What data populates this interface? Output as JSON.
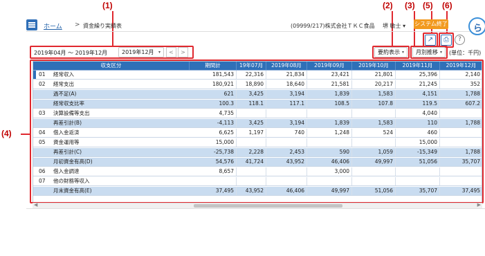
{
  "callouts": [
    "(1)",
    "(2)",
    "(3)",
    "(5)",
    "(6)",
    "(4)"
  ],
  "header": {
    "home": "ホーム",
    "separator": ">",
    "page_title": "資金繰り実績表",
    "company": "(09999/217)株式会社ＴＫＣ食品",
    "user": "堺 敏士",
    "user_caret": "▾",
    "system_end": "システム終了",
    "avatar_glyph": "ら"
  },
  "icons": {
    "menu": "hamburger-menu-icon",
    "export": "↗",
    "print": "⎙",
    "help": "?"
  },
  "filters": {
    "period": "2019年04月 ～ 2019年12月",
    "month_select": "2019年12月",
    "prev": "<",
    "next": ">",
    "summary_select": "要約表示",
    "view_select": "月別推移",
    "caret": "▾",
    "unit": "(単位：千円)"
  },
  "table": {
    "columns": [
      "収支区分",
      "期間計",
      "19年07月",
      "2019年08月",
      "2019年09月",
      "2019年10月",
      "2019年11月",
      "2019年12月"
    ],
    "rows": [
      {
        "code": "01",
        "label": "経常収入",
        "values": [
          "181,543",
          "22,316",
          "21,834",
          "23,421",
          "21,801",
          "25,396",
          "2,140"
        ],
        "style": "white"
      },
      {
        "code": "02",
        "label": "経常支出",
        "values": [
          "180,921",
          "18,890",
          "18,640",
          "21,581",
          "20,217",
          "21,245",
          "352"
        ],
        "style": "white"
      },
      {
        "code": "",
        "label": "過不足(A)",
        "values": [
          "621",
          "3,425",
          "3,194",
          "1,839",
          "1,583",
          "4,151",
          "1,788"
        ],
        "style": "blue"
      },
      {
        "code": "",
        "label": "経常収支比率",
        "values": [
          "100.3",
          "118.1",
          "117.1",
          "108.5",
          "107.8",
          "119.5",
          "607.2"
        ],
        "style": "blue"
      },
      {
        "code": "03",
        "label": "決算設備等支出",
        "values": [
          "4,735",
          "",
          "",
          "",
          "",
          "4,040",
          ""
        ],
        "style": "white"
      },
      {
        "code": "",
        "label": "再差引計(B)",
        "values": [
          "-4,113",
          "3,425",
          "3,194",
          "1,839",
          "1,583",
          "110",
          "1,788"
        ],
        "style": "blue"
      },
      {
        "code": "04",
        "label": "借入金返済",
        "values": [
          "6,625",
          "1,197",
          "740",
          "1,248",
          "524",
          "460",
          ""
        ],
        "style": "white"
      },
      {
        "code": "05",
        "label": "資金運用等",
        "values": [
          "15,000",
          "",
          "",
          "",
          "",
          "15,000",
          ""
        ],
        "style": "white"
      },
      {
        "code": "",
        "label": "再差引計(C)",
        "values": [
          "-25,738",
          "2,228",
          "2,453",
          "590",
          "1,059",
          "-15,349",
          "1,788"
        ],
        "style": "blue"
      },
      {
        "code": "",
        "label": "月初資金有高(D)",
        "values": [
          "54,576",
          "41,724",
          "43,952",
          "46,406",
          "49,997",
          "51,056",
          "35,707"
        ],
        "style": "blue"
      },
      {
        "code": "06",
        "label": "借入金調達",
        "values": [
          "8,657",
          "",
          "",
          "3,000",
          "",
          "",
          ""
        ],
        "style": "white"
      },
      {
        "code": "07",
        "label": "他の財務等収入",
        "values": [
          "",
          "",
          "",
          "",
          "",
          "",
          ""
        ],
        "style": "white"
      },
      {
        "code": "",
        "label": "月末資金有高(E)",
        "values": [
          "37,495",
          "43,952",
          "46,406",
          "49,997",
          "51,056",
          "35,707",
          "37,495"
        ],
        "style": "blue"
      }
    ]
  },
  "scroll": {
    "left": "◀",
    "right": "▶"
  }
}
